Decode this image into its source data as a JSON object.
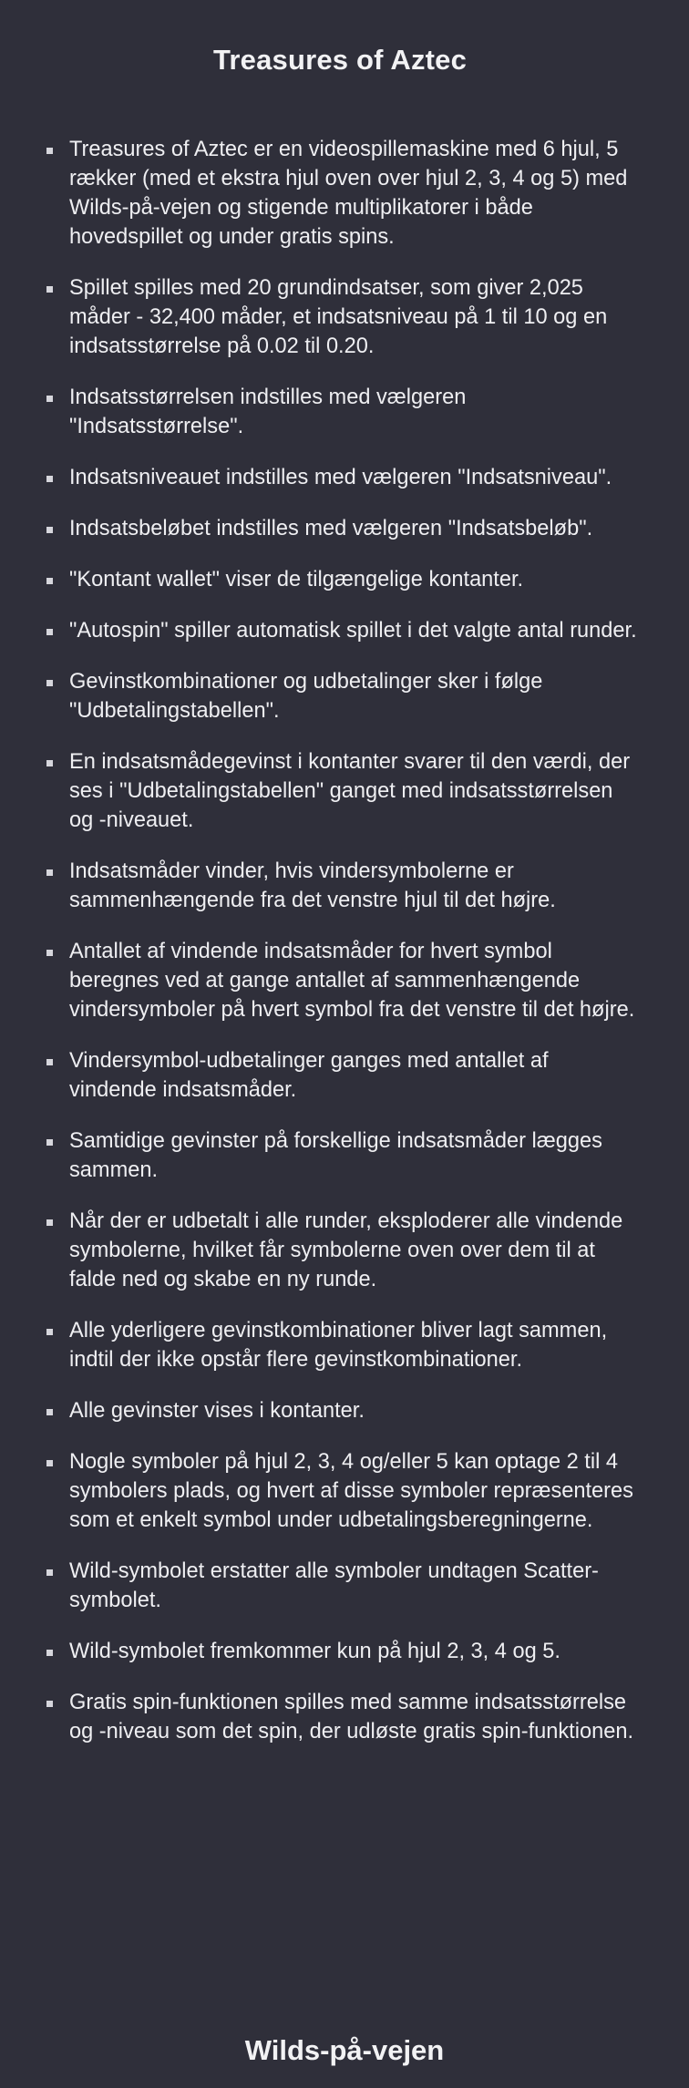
{
  "page": {
    "title": "Treasures of Aztec",
    "section_title": "Wilds-på-vejen"
  },
  "rules": [
    "Treasures of Aztec er en videospillemaskine med 6 hjul, 5 rækker (med et ekstra hjul oven over hjul 2, 3, 4 og 5) med Wilds-på-vejen og stigende multiplikatorer i både hovedspillet og under gratis spins.",
    "Spillet spilles med 20 grundindsatser, som giver 2,025 måder - 32,400 måder, et indsatsniveau på 1 til 10 og en indsatsstørrelse på 0.02 til 0.20.",
    "Indsatsstørrelsen indstilles med vælgeren \"Indsatsstørrelse\".",
    "Indsatsniveauet indstilles med vælgeren \"Indsatsniveau\".",
    "Indsatsbeløbet indstilles med vælgeren \"Indsatsbeløb\".",
    "\"Kontant wallet\" viser de tilgængelige kontanter.",
    "\"Autospin\" spiller automatisk spillet i det valgte antal runder.",
    "Gevinstkombinationer og udbetalinger sker i følge \"Udbetalingstabellen\".",
    "En indsatsmådegevinst i kontanter svarer til den værdi, der ses i \"Udbetalingstabellen\" ganget med indsatsstørrelsen og -niveauet.",
    "Indsatsmåder vinder, hvis vindersymbolerne er sammenhængende fra det venstre hjul til det højre.",
    "Antallet af vindende indsatsmåder for hvert symbol beregnes ved at gange antallet af sammenhængende vindersymboler på hvert symbol fra det venstre til det højre.",
    "Vindersymbol-udbetalinger ganges med antallet af vindende indsatsmåder.",
    "Samtidige gevinster på forskellige indsatsmåder lægges sammen.",
    "Når der er udbetalt i alle runder, eksploderer alle vindende symbolerne, hvilket får symbolerne oven over dem til at falde ned og skabe en ny runde.",
    "Alle yderligere gevinstkombinationer bliver lagt sammen, indtil der ikke opstår flere gevinstkombinationer.",
    "Alle gevinster vises i kontanter.",
    "Nogle symboler på hjul 2, 3, 4 og/eller 5 kan optage 2 til 4 symbolers plads, og hvert af disse symboler repræsenteres som et enkelt symbol under udbetalingsberegningerne.",
    "Wild-symbolet erstatter alle symboler undtagen Scatter-symbolet.",
    "Wild-symbolet fremkommer kun på hjul 2, 3, 4 og 5.",
    "Gratis spin-funktionen spilles med samme indsatsstørrelse og -niveau som det spin, der udløste gratis spin-funktionen."
  ],
  "colors": {
    "background": "#2f2f3a",
    "text": "#f2f2f4",
    "bullet": "#d6d6dc"
  }
}
